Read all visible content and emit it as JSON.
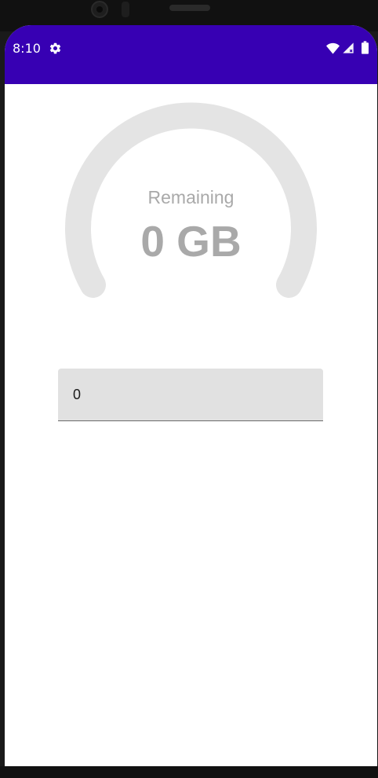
{
  "status_bar": {
    "time": "8:10",
    "background_color": "#3700b3",
    "icons": [
      "gear-icon",
      "wifi-icon",
      "signal-icon",
      "battery-icon"
    ]
  },
  "gauge": {
    "label": "Remaining",
    "value": "0 GB",
    "fill_fraction": 0,
    "track_color": "#e4e4e4",
    "text_color": "#a9a9a9"
  },
  "input": {
    "value": "0"
  }
}
